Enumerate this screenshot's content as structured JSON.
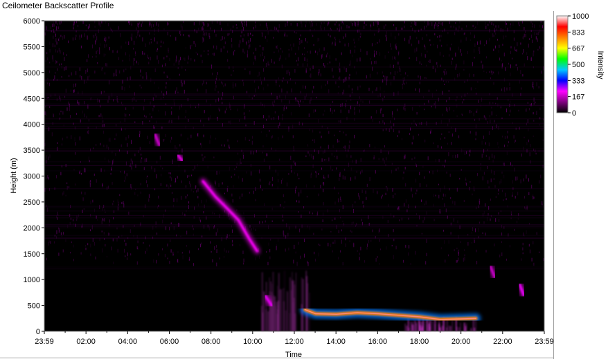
{
  "window": {
    "title": "Ceilometer Backscatter Profile"
  },
  "chart_data": {
    "type": "heatmap",
    "title": "Ceilometer Backscatter Profile",
    "xlabel": "Time",
    "ylabel": "Height (m)",
    "x_ticks": [
      "23:59",
      "02:00",
      "04:00",
      "06:00",
      "08:00",
      "10:00",
      "12:00",
      "14:00",
      "16:00",
      "18:00",
      "20:00",
      "22:00",
      "23:59"
    ],
    "y_ticks": [
      0,
      500,
      1000,
      1500,
      2000,
      2500,
      3000,
      3500,
      4000,
      4500,
      5000,
      5500,
      6000
    ],
    "ylim": [
      0,
      6000
    ],
    "xlim_hours": [
      -0.0167,
      23.9833
    ],
    "colorbar": {
      "label": "Intensity",
      "ticks": [
        0,
        167,
        333,
        500,
        667,
        833,
        1000
      ],
      "range": [
        0,
        1000
      ],
      "colors": [
        "#000000",
        "#800080",
        "#ff00ff",
        "#0000ff",
        "#00c8ff",
        "#00ff00",
        "#ffff00",
        "#ff8000",
        "#ff0000",
        "#ffffff"
      ]
    },
    "layers": [
      {
        "name": "cloud-layer",
        "points": [
          [
            12.5,
            420
          ],
          [
            13.0,
            340
          ],
          [
            14.0,
            330
          ],
          [
            15.0,
            360
          ],
          [
            16.0,
            340
          ],
          [
            17.0,
            310
          ],
          [
            18.0,
            280
          ],
          [
            19.0,
            230
          ],
          [
            20.0,
            240
          ],
          [
            20.7,
            250
          ]
        ],
        "intensity": 780
      },
      {
        "name": "descending-plume",
        "points": [
          [
            7.6,
            2900
          ],
          [
            8.2,
            2600
          ],
          [
            8.7,
            2400
          ],
          [
            9.3,
            2150
          ],
          [
            9.8,
            1800
          ],
          [
            10.2,
            1550
          ]
        ],
        "intensity": 220
      },
      {
        "name": "streak-1",
        "points": [
          [
            5.3,
            3800
          ],
          [
            5.5,
            3600
          ]
        ],
        "intensity": 180
      },
      {
        "name": "streak-2",
        "points": [
          [
            6.4,
            3400
          ],
          [
            6.6,
            3300
          ]
        ],
        "intensity": 200
      },
      {
        "name": "streak-3",
        "points": [
          [
            10.6,
            680
          ],
          [
            10.9,
            500
          ]
        ],
        "intensity": 230
      },
      {
        "name": "late-streak",
        "points": [
          [
            21.4,
            1250
          ],
          [
            21.6,
            1050
          ]
        ],
        "intensity": 180
      },
      {
        "name": "late-streak-2",
        "points": [
          [
            22.8,
            900
          ],
          [
            23.0,
            700
          ]
        ],
        "intensity": 230
      }
    ]
  }
}
